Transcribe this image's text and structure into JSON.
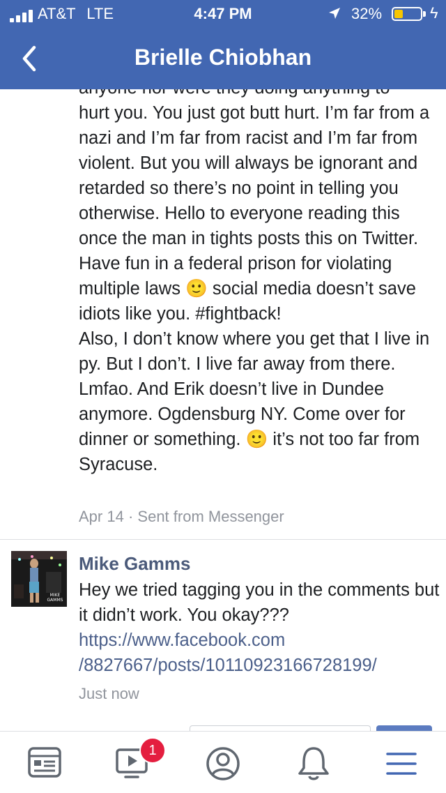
{
  "status_bar": {
    "carrier": "AT&T",
    "network": "LTE",
    "time": "4:47 PM",
    "battery_percent": "32%",
    "battery_level": 0.32,
    "battery_color": "#f7c600"
  },
  "header": {
    "title": "Brielle Chiobhan",
    "back_icon": "chevron-left-icon",
    "color": "#4267b2"
  },
  "post": {
    "text_top_partial": "anyone nor were they doing anything to",
    "text_main": "hurt you. You just got butt hurt. I’m far from a nazi and I’m far from racist and I’m far from violent. But you will always be ignorant and retarded so there’s no point in telling you otherwise. Hello to everyone reading this once the man in tights posts this on Twitter. Have fun in a federal prison for violating multiple laws",
    "text_after_emoji_1": "social media doesn’t save idiots like you. #fightback!",
    "text_para_2": "Also, I don’t know where you get that I live in py. But I don’t. I live far away from there. Lmfao. And Erik doesn’t live in Dundee anymore. Ogdensburg NY. Come over for dinner or something.",
    "text_after_emoji_2": "it’s not too far from Syracuse.",
    "emoji": "🙂",
    "date": "Apr 14",
    "separator": "·",
    "source": "Sent from Messenger"
  },
  "comment": {
    "author": "Mike Gamms",
    "text": "Hey we tried tagging you in the comments but it didn’t work. You okay???",
    "link": "https://www.facebook.com/8827667/posts/10110923166728199/",
    "link_line_1": "https://www.facebook.com",
    "link_line_2": "/8827667/posts/10110923166728199/",
    "time": "Just now",
    "avatar_label": "MIKE GAMMS"
  },
  "tabbar": {
    "items": [
      {
        "icon": "news-feed-icon"
      },
      {
        "icon": "video-icon",
        "badge": "1"
      },
      {
        "icon": "profile-icon"
      },
      {
        "icon": "bell-icon"
      },
      {
        "icon": "menu-icon"
      }
    ],
    "active_color": "#4267b2",
    "badge_color": "#e41e3f"
  }
}
